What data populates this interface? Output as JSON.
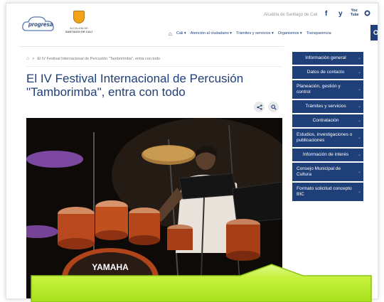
{
  "header": {
    "logo_text": "progresa",
    "alcaldia_line1": "ALCALDÍA DE",
    "alcaldia_line2": "SANTIAGO DE CALI",
    "site_link": "Alcaldía de Santiago de Cali",
    "social": [
      "f",
      "y",
      "You Tube"
    ]
  },
  "nav": {
    "items": [
      "Cali",
      "Atención al ciudadano",
      "Trámites y servicios",
      "Organismos",
      "Transparencia"
    ]
  },
  "breadcrumb": {
    "separator": ">",
    "current": "El IV Festival Internacional de Percusión \"Tamborimba\", entra con todo"
  },
  "article": {
    "title": "El IV Festival Internacional de Percusión \"Tamborimba\", entra con todo",
    "drum_brand": "YAMAHA"
  },
  "sidebar": {
    "items": [
      "Información general",
      "Datos de contacto",
      "Planeación, gestión y control",
      "Trámites y servicios",
      "Contratación",
      "Estudios, investigaciones o publicaciones",
      "Información de interés",
      "Consejo Municipal de Cultura",
      "Formato solicitud concepto BIC"
    ]
  },
  "colors": {
    "brand_blue": "#1f3f78",
    "callout_green": "#c8f542"
  }
}
